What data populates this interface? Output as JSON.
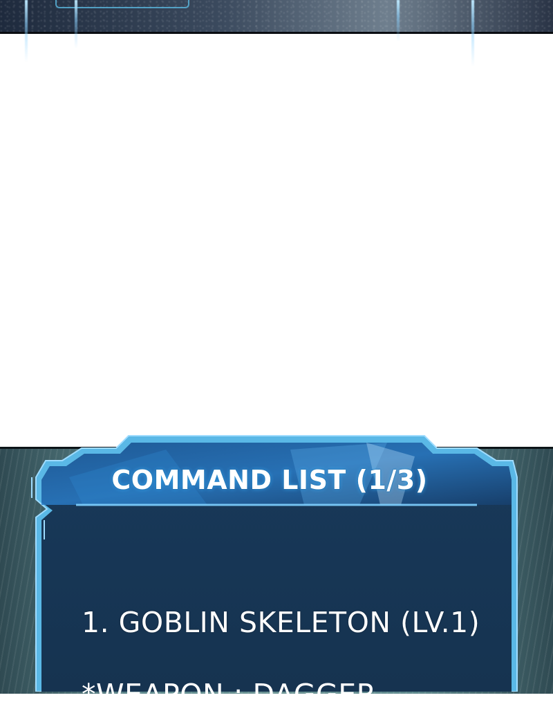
{
  "panel": {
    "title": "COMMAND LIST (1/3)",
    "items": [
      {
        "text": "1. GOBLIN SKELETON (LV.1)"
      },
      {
        "text": "*WEAPON : DAGGER"
      }
    ]
  },
  "colors": {
    "panel_fill": "#173450",
    "panel_border": "#5ab8e6",
    "title_glow": "#3cb4ff",
    "background_top": "#ffffff"
  }
}
